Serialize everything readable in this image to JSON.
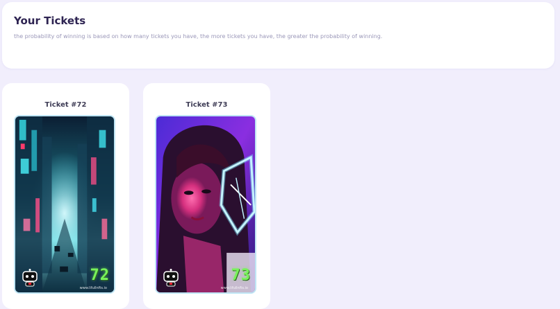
{
  "header": {
    "title": "Your Tickets",
    "subtitle": "the probability of winning is based on how many tickets you have, the more tickets you have, the greater the probability of winning."
  },
  "tickets": [
    {
      "title": "Ticket #72",
      "number": "72",
      "site": "www.lifullnfts.io",
      "art": "neon-city-street"
    },
    {
      "title": "Ticket #73",
      "number": "73",
      "site": "www.lifullnfts.io",
      "art": "neon-portrait"
    }
  ],
  "colors": {
    "background": "#f1eefc",
    "card": "#ffffff",
    "title": "#2e2452",
    "number": "#78f25a"
  }
}
